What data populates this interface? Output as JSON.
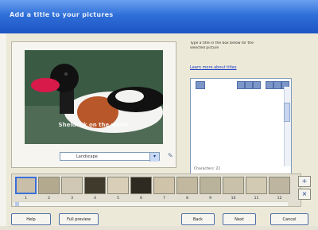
{
  "window": {
    "title": "Add a title to your pictures"
  },
  "preview": {
    "caption_overlay": "Shelduck on the water",
    "picture_select_value": "Landscape"
  },
  "panel": {
    "instructions": [
      "Type a title in the box below for the",
      "selected picture"
    ],
    "link": "Learn more about titles",
    "editor_status": "Characters: 21"
  },
  "filmstrip": {
    "thumb_numbers": [
      "1",
      "2",
      "3",
      "4",
      "5",
      "6",
      "7",
      "8",
      "9",
      "10",
      "11",
      "12"
    ],
    "thumb_colors": [
      "#c9bfa8",
      "#b3a98f",
      "#d0c7b4",
      "#3f3a2c",
      "#d9cfb8",
      "#2e2a22",
      "#cfc3a9",
      "#c2b8a0",
      "#b9b39b",
      "#cac1ab",
      "#d3cab4",
      "#bdb5a0"
    ]
  },
  "buttons": {
    "help": "Help",
    "preview": "Full preview",
    "back": "Back",
    "next": "Next",
    "cancel": "Cancel"
  }
}
